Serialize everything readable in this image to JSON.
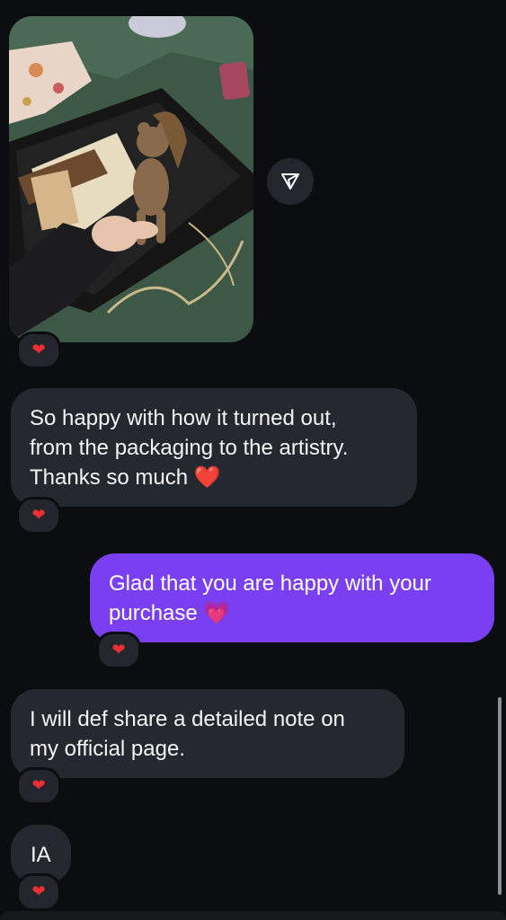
{
  "photo_message": {
    "alt": "Photo of a crocheted teddy bear held over a black gift box"
  },
  "share_button": {
    "icon": "send-plane-icon"
  },
  "reaction_emoji": "❤",
  "messages": [
    {
      "direction": "incoming",
      "lines": [
        "So happy with how it turned out,",
        "from the packaging to the artistry."
      ],
      "last_line": "Thanks so much ",
      "emoji": "❤️",
      "reaction": "❤"
    },
    {
      "direction": "outgoing",
      "lines": [
        "Glad that you are happy with your"
      ],
      "last_line": "purchase ",
      "emoji": "💗",
      "reaction": "❤"
    },
    {
      "direction": "incoming",
      "lines": [
        "I will def share a detailed note on"
      ],
      "last_line": "my official page.",
      "emoji": "",
      "reaction": "❤"
    },
    {
      "direction": "incoming",
      "lines": [],
      "last_line": "IA",
      "emoji": "",
      "reaction": "❤"
    }
  ],
  "colors": {
    "background": "#0b0d11",
    "incoming_bubble": "#25282e",
    "outgoing_bubble": "#7b3ff2",
    "reaction_heart": "#ef2f35"
  }
}
